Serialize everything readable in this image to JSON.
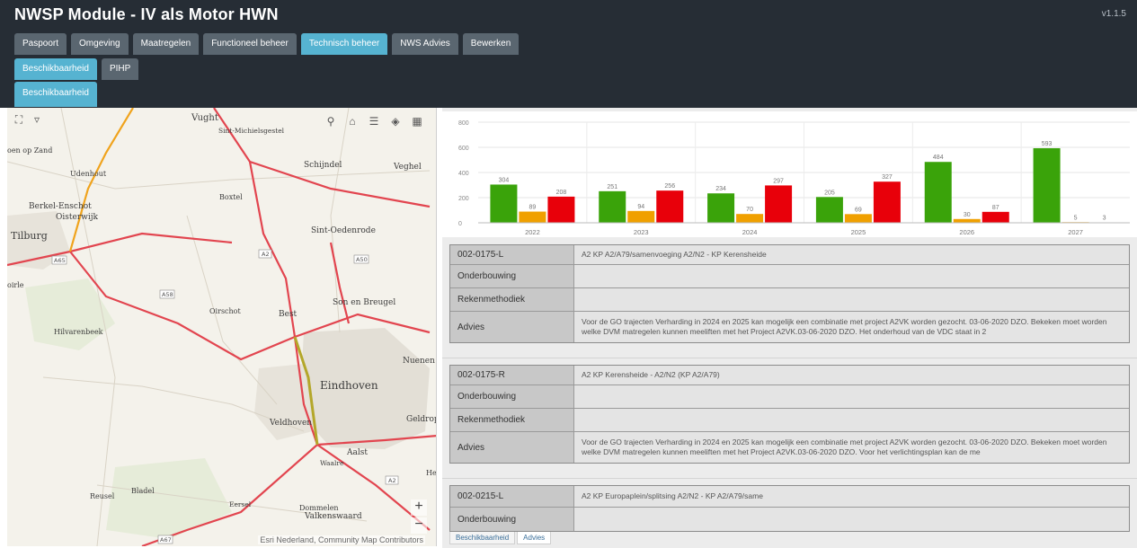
{
  "app": {
    "title": "NWSP Module - IV als Motor HWN",
    "version": "v1.1.5"
  },
  "main_tabs": [
    {
      "label": "Paspoort",
      "active": false
    },
    {
      "label": "Omgeving",
      "active": false
    },
    {
      "label": "Maatregelen",
      "active": false
    },
    {
      "label": "Functioneel beheer",
      "active": false
    },
    {
      "label": "Technisch beheer",
      "active": true
    },
    {
      "label": "NWS Advies",
      "active": false
    },
    {
      "label": "Bewerken",
      "active": false
    }
  ],
  "sub_tabs": [
    {
      "label": "Beschikbaarheid",
      "active": true
    },
    {
      "label": "PIHP",
      "active": false
    }
  ],
  "sub2_tabs": [
    {
      "label": "Beschikbaarheid",
      "active": true
    }
  ],
  "map": {
    "labels": [
      "Vught",
      "Sint-Michielsgestel",
      "Schijndel",
      "Veghel",
      "oen op Zand",
      "Udenhout",
      "Boxtel",
      "Berkel-Enschot",
      "Oisterwijk",
      "Tilburg",
      "Sint-Oedenrode",
      "oirle",
      "Oirschot",
      "Best",
      "Son en Breugel",
      "Hilvarenbeek",
      "Nuenen",
      "Eindhoven",
      "Veldhoven",
      "Geldrop",
      "Aalst",
      "Waalre",
      "Bladel",
      "Reusel",
      "Eersel",
      "Dommelen",
      "Valkenswaard",
      "He"
    ],
    "shields": [
      "A2",
      "A65",
      "A50",
      "A58",
      "A2",
      "A67"
    ],
    "attribution": "Esri Nederland, Community Map Contributors",
    "zoom_in": "+",
    "zoom_out": "−"
  },
  "chart_data": {
    "type": "bar",
    "categories": [
      "2022",
      "2023",
      "2024",
      "2025",
      "2026",
      "2027"
    ],
    "series": [
      {
        "color": "#3aa30a",
        "values": [
          304,
          251,
          234,
          205,
          484,
          593
        ]
      },
      {
        "color": "#f0a000",
        "values": [
          89,
          94,
          70,
          69,
          30,
          5
        ]
      },
      {
        "color": "#e8000a",
        "values": [
          208,
          256,
          297,
          327,
          87,
          3
        ]
      }
    ],
    "ylim": [
      0,
      800
    ],
    "yticks": [
      0,
      200,
      400,
      600,
      800
    ],
    "grid": true,
    "title": "",
    "xlabel": "",
    "ylabel": ""
  },
  "records": [
    {
      "id": "002-0175-L",
      "description": "A2 KP A2/A79/samenvoeging A2/N2 - KP Kerensheide",
      "rows": [
        {
          "label": "Onderbouwing",
          "value": ""
        },
        {
          "label": "Rekenmethodiek",
          "value": ""
        },
        {
          "label": "Advies",
          "value": "Voor de GO trajecten Verharding in 2024 en 2025 kan mogelijk een combinatie met project A2VK worden gezocht. 03-06-2020 DZO. Bekeken moet worden welke DVM matregelen kunnen meeliften met het Project A2VK.03-06-2020 DZO. Het onderhoud van de VDC staat in 2"
        }
      ]
    },
    {
      "id": "002-0175-R",
      "description": "A2 KP Kerensheide - A2/N2 (KP A2/A79)",
      "rows": [
        {
          "label": "Onderbouwing",
          "value": ""
        },
        {
          "label": "Rekenmethodiek",
          "value": ""
        },
        {
          "label": "Advies",
          "value": "Voor de GO trajecten Verharding in 2024 en 2025 kan mogelijk een combinatie met project A2VK worden gezocht. 03-06-2020 DZO. Bekeken moet worden welke DVM matregelen kunnen meeliften met het Project A2VK.03-06-2020 DZO. Voor het verlichtingsplan kan de me"
        }
      ]
    },
    {
      "id": "002-0215-L",
      "description": "A2 KP Europaplein/splitsing A2/N2 - KP A2/A79/same",
      "rows": [
        {
          "label": "Onderbouwing",
          "value": ""
        }
      ]
    }
  ],
  "bottom_tabs": [
    {
      "label": "Beschikbaarheid",
      "active": false
    },
    {
      "label": "Advies",
      "active": true
    }
  ]
}
